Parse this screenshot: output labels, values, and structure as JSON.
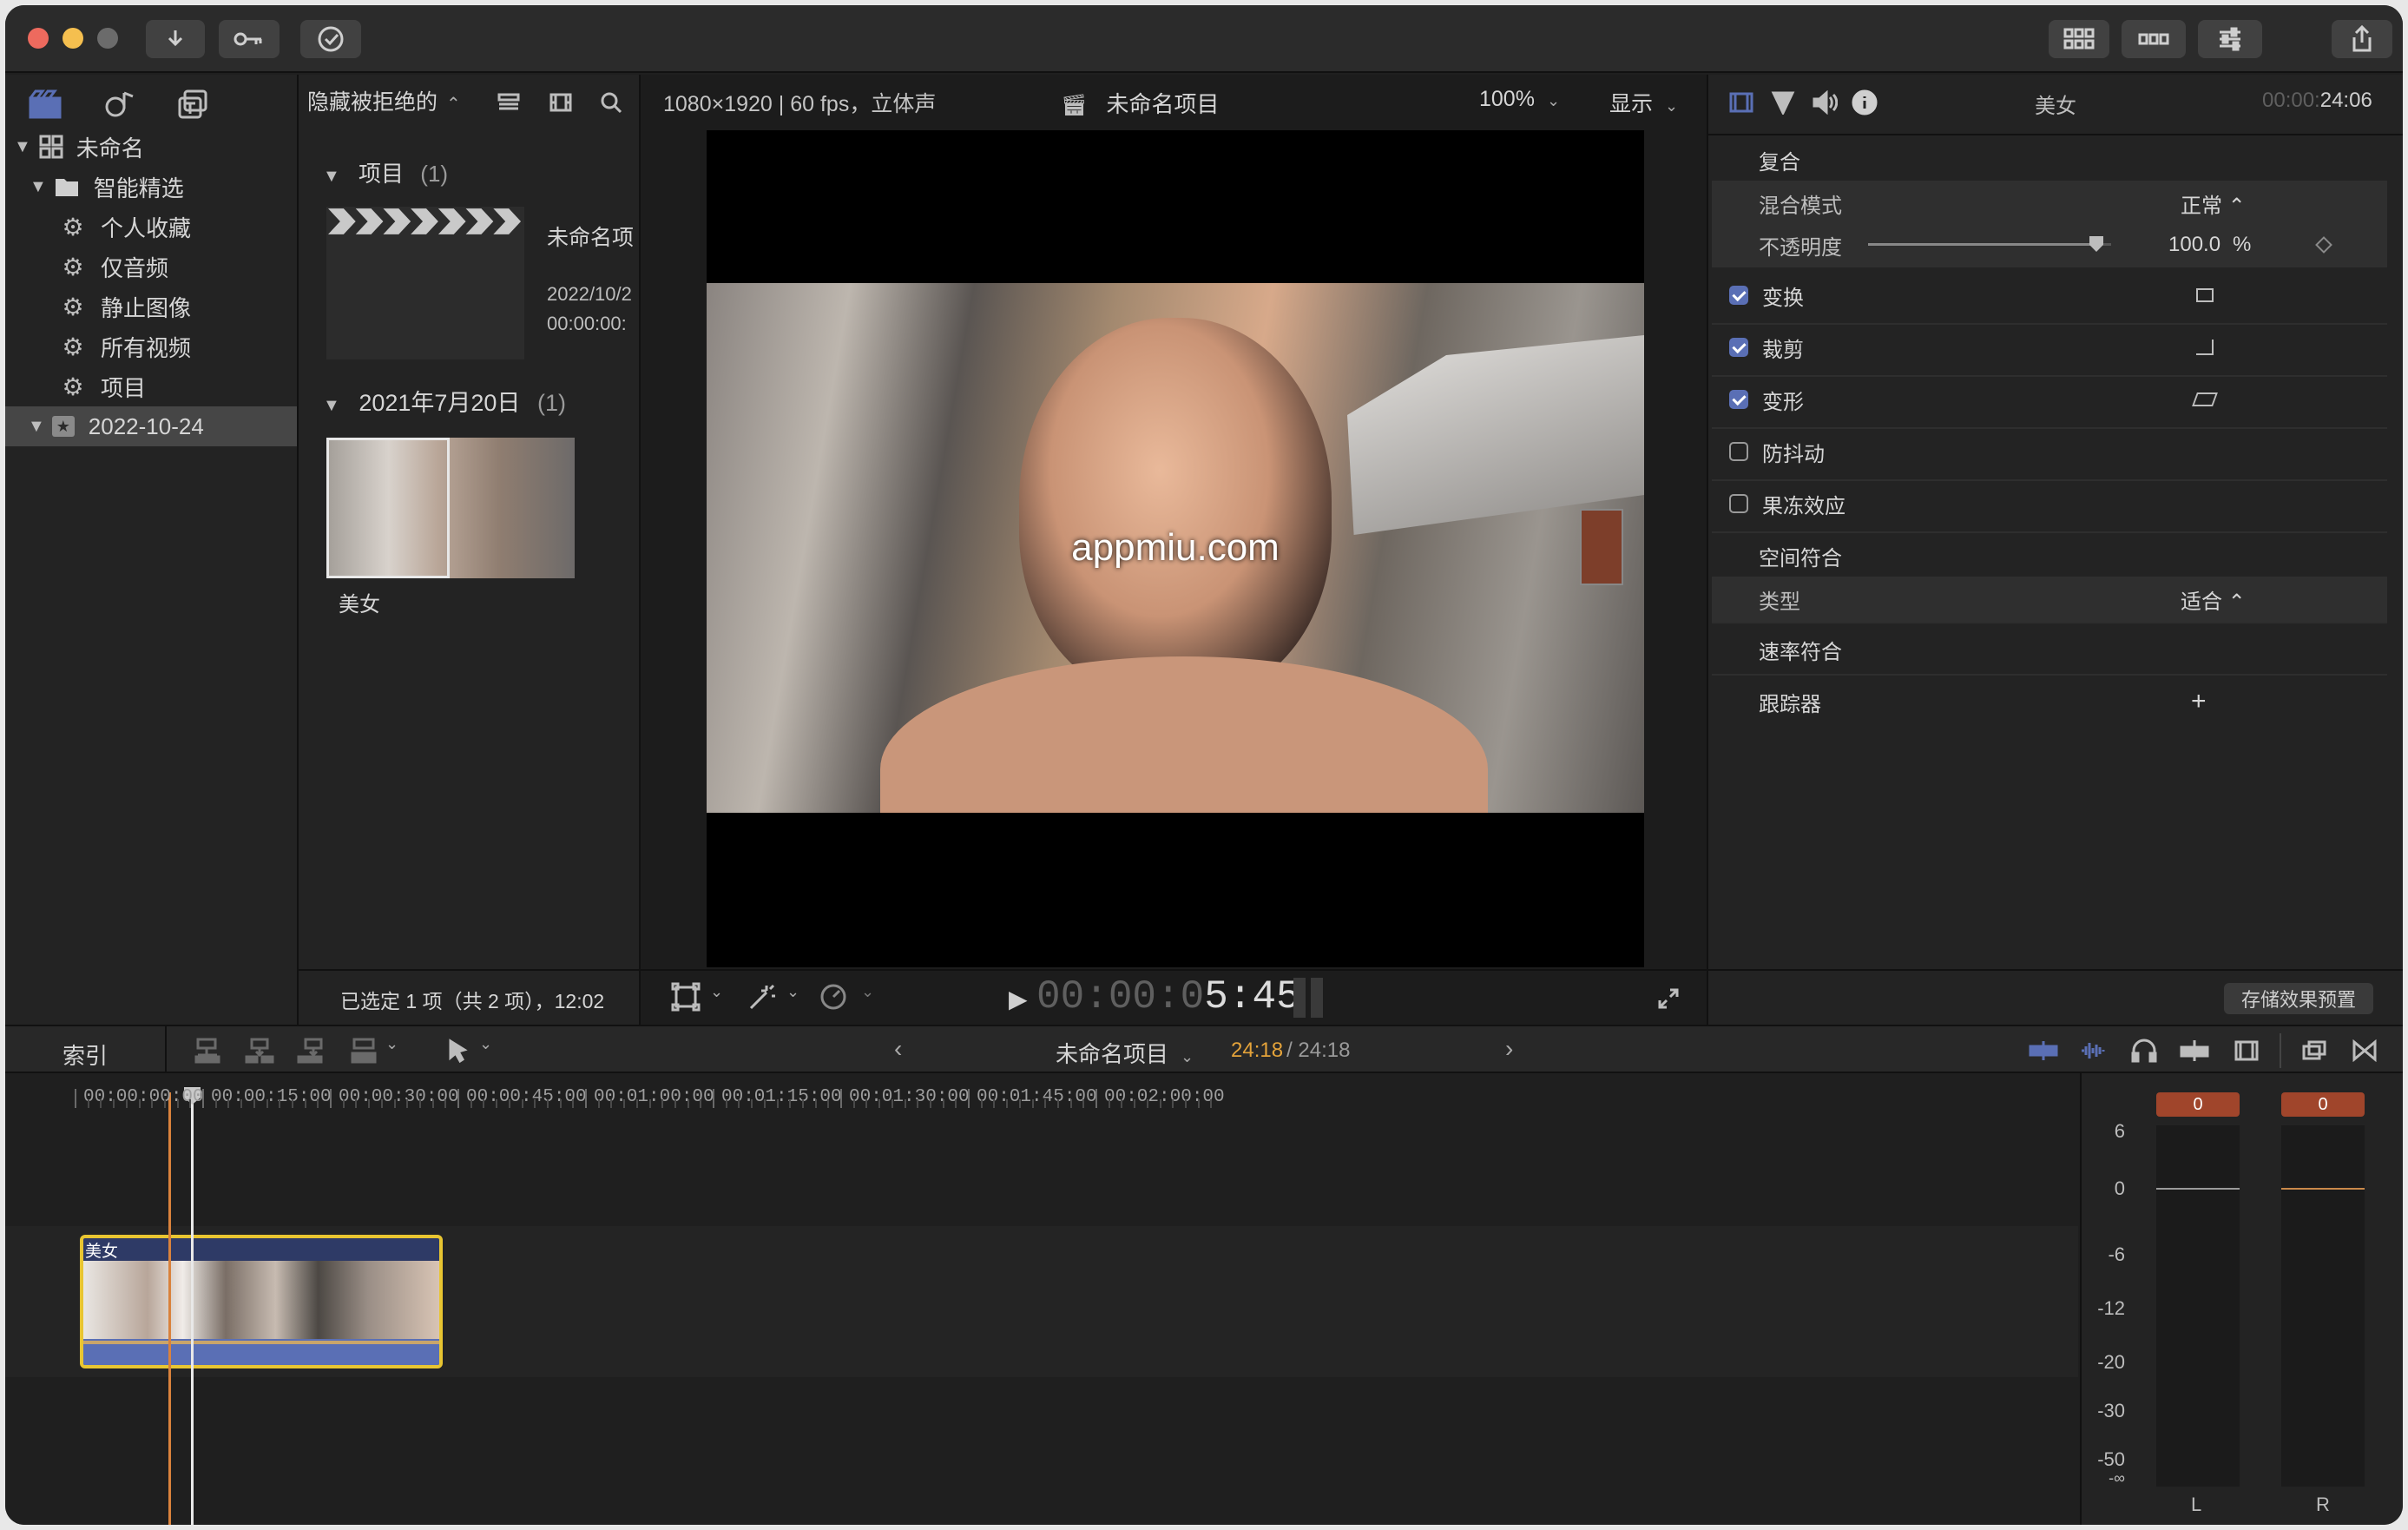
{
  "titlebar": {
    "buttons": [
      "import",
      "keywords",
      "background-tasks"
    ],
    "right_buttons": [
      "browser-toggle",
      "timeline-toggle",
      "inspector-toggle",
      "share"
    ]
  },
  "browser_toolbar": {
    "filter_label": "隐藏被拒绝的"
  },
  "library": {
    "root": "未命名",
    "smart_folder": "智能精选",
    "collections": [
      "个人收藏",
      "仅音频",
      "静止图像",
      "所有视频",
      "项目"
    ],
    "event": "2022-10-24"
  },
  "browser": {
    "section1_title": "项目",
    "section1_count": "(1)",
    "project_name": "未命名项",
    "project_date": "2022/10/2",
    "project_duration": "00:00:00:",
    "section2_title": "2021年7月20日",
    "section2_count": "(1)",
    "clip_name": "美女",
    "status": "已选定 1 项（共 2 项），12:02"
  },
  "viewer": {
    "format": "1080×1920 | 60 fps，立体声",
    "project_title": "未命名项目",
    "zoom": "100%",
    "display_label": "显示",
    "watermark": "appmiu.com",
    "timecode_dim": "00:00:0",
    "timecode_bright": "5:45"
  },
  "inspector": {
    "clip_title": "美女",
    "time_dim": "00:00:",
    "time_bright": "24:06",
    "section_composite": "复合",
    "blend_mode_label": "混合模式",
    "blend_mode_value": "正常 ⌃",
    "opacity_label": "不透明度",
    "opacity_value": "100.0",
    "opacity_unit": "%",
    "opacity_level": 1.0,
    "transform": "变换",
    "crop": "裁剪",
    "distort": "变形",
    "stabilization": "防抖动",
    "rolling_shutter": "果冻效应",
    "spatial_conform": "空间符合",
    "type_label": "类型",
    "type_value": "适合 ⌃",
    "rate_conform": "速率符合",
    "tracker": "跟踪器",
    "tracker_add": "+",
    "save_preset": "存储效果预置"
  },
  "timeline": {
    "index_label": "索引",
    "project_name": "未命名项目",
    "duration_current": "24:18",
    "duration_total": "/ 24:18",
    "ruler": [
      "00:00:00:00",
      "00:00:15:00",
      "00:00:30:00",
      "00:00:45:00",
      "00:01:00:00",
      "00:01:15:00",
      "00:01:30:00",
      "00:01:45:00",
      "00:02:00:00"
    ],
    "clip_name": "美女"
  },
  "meters": {
    "peak_left": "0",
    "peak_right": "0",
    "scale": [
      "6",
      "0",
      "-6",
      "-12",
      "-20",
      "-30",
      "-50",
      "-∞"
    ],
    "channel_left": "L",
    "channel_right": "R"
  },
  "colors": {
    "accent_blue": "#5a6fb5",
    "clip_border": "#e8c531",
    "playhead_orange": "#d9823c",
    "timecode_orange": "#e4a33a"
  }
}
